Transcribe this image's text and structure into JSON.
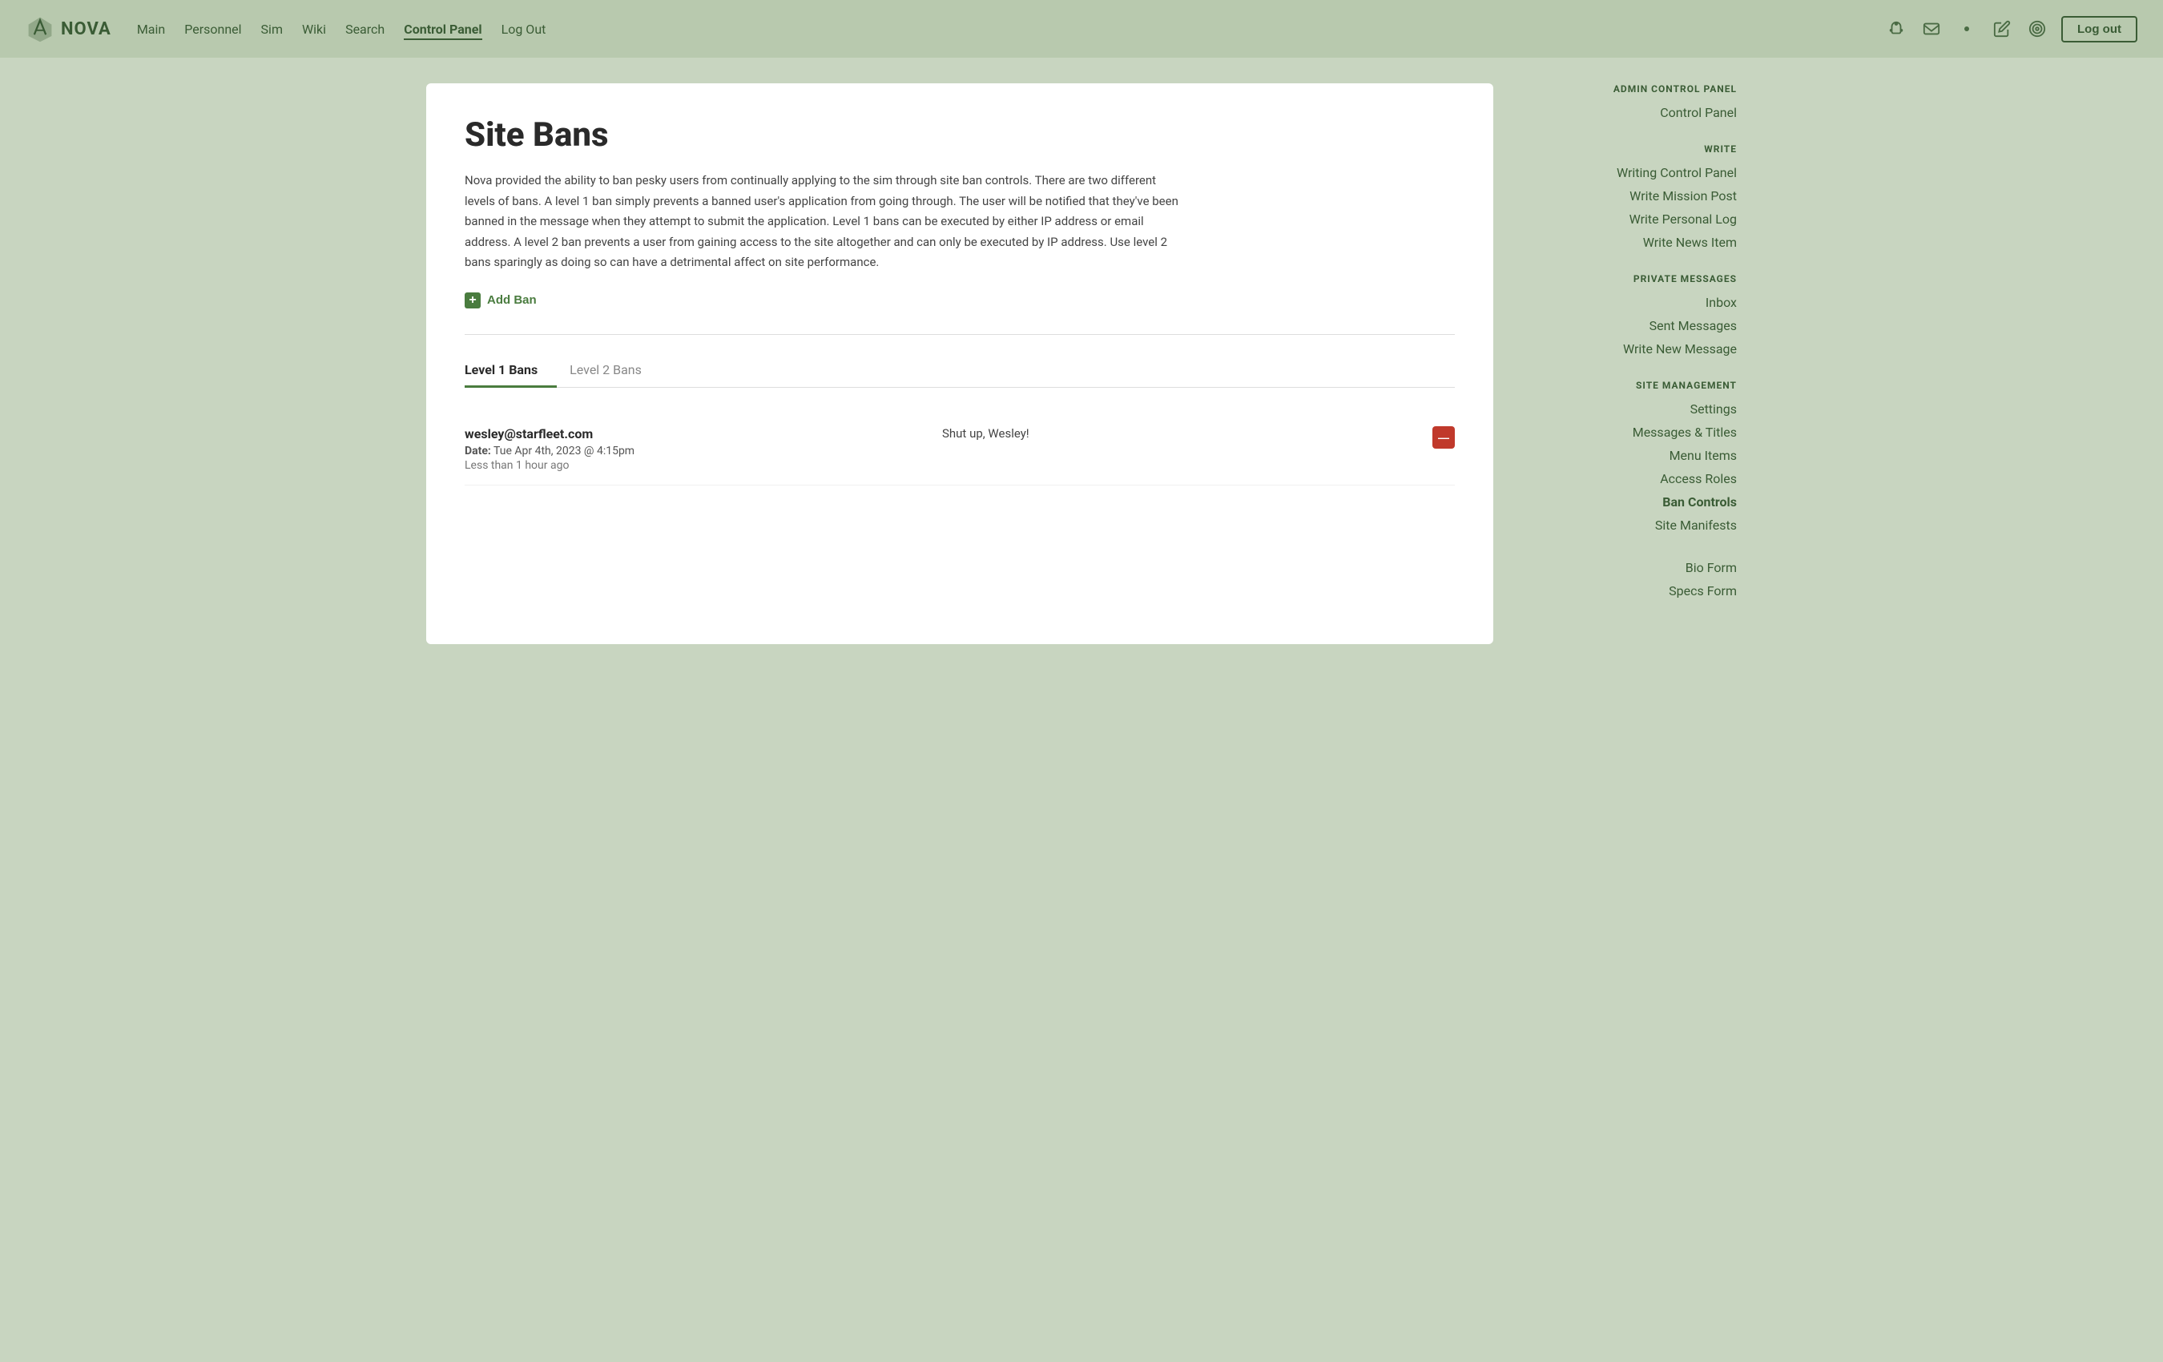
{
  "nav": {
    "logo_text": "NOVA",
    "links": [
      {
        "label": "Main",
        "active": false
      },
      {
        "label": "Personnel",
        "active": false
      },
      {
        "label": "Sim",
        "active": false
      },
      {
        "label": "Wiki",
        "active": false
      },
      {
        "label": "Search",
        "active": false
      },
      {
        "label": "Control Panel",
        "active": true
      },
      {
        "label": "Log Out",
        "active": false
      }
    ],
    "logout_label": "Log out"
  },
  "page": {
    "title": "Site Bans",
    "description": "Nova provided the ability to ban pesky users from continually applying to the sim through site ban controls. There are two different levels of bans. A level 1 ban simply prevents a banned user's application from going through. The user will be notified that they've been banned in the message when they attempt to submit the application. Level 1 bans can be executed by either IP address or email address. A level 2 ban prevents a user from gaining access to the site altogether and can only be executed by IP address. Use level 2 bans sparingly as doing so can have a detrimental affect on site performance.",
    "add_ban_label": "Add Ban"
  },
  "tabs": [
    {
      "label": "Level 1 Bans",
      "active": true
    },
    {
      "label": "Level 2 Bans",
      "active": false
    }
  ],
  "bans": [
    {
      "email": "wesley@starfleet.com",
      "date_label": "Date:",
      "date_value": "Tue Apr 4th, 2023 @ 4:15pm",
      "relative_time": "Less than 1 hour ago",
      "reason": "Shut up, Wesley!"
    }
  ],
  "sidebar": {
    "sections": [
      {
        "title": "ADMIN CONTROL PANEL",
        "links": [
          {
            "label": "Control Panel",
            "active": false
          }
        ]
      },
      {
        "title": "WRITE",
        "links": [
          {
            "label": "Writing Control Panel",
            "active": false
          },
          {
            "label": "Write Mission Post",
            "active": false
          },
          {
            "label": "Write Personal Log",
            "active": false
          },
          {
            "label": "Write News Item",
            "active": false
          }
        ]
      },
      {
        "title": "PRIVATE MESSAGES",
        "links": [
          {
            "label": "Inbox",
            "active": false
          },
          {
            "label": "Sent Messages",
            "active": false
          },
          {
            "label": "Write New Message",
            "active": false
          }
        ]
      },
      {
        "title": "SITE MANAGEMENT",
        "links": [
          {
            "label": "Settings",
            "active": false
          },
          {
            "label": "Messages & Titles",
            "active": false
          },
          {
            "label": "Menu Items",
            "active": false
          },
          {
            "label": "Access Roles",
            "active": false
          },
          {
            "label": "Ban Controls",
            "active": true
          },
          {
            "label": "Site Manifests",
            "active": false
          }
        ]
      },
      {
        "title": "",
        "links": [
          {
            "label": "Bio Form",
            "active": false
          },
          {
            "label": "Specs Form",
            "active": false
          }
        ]
      }
    ]
  }
}
